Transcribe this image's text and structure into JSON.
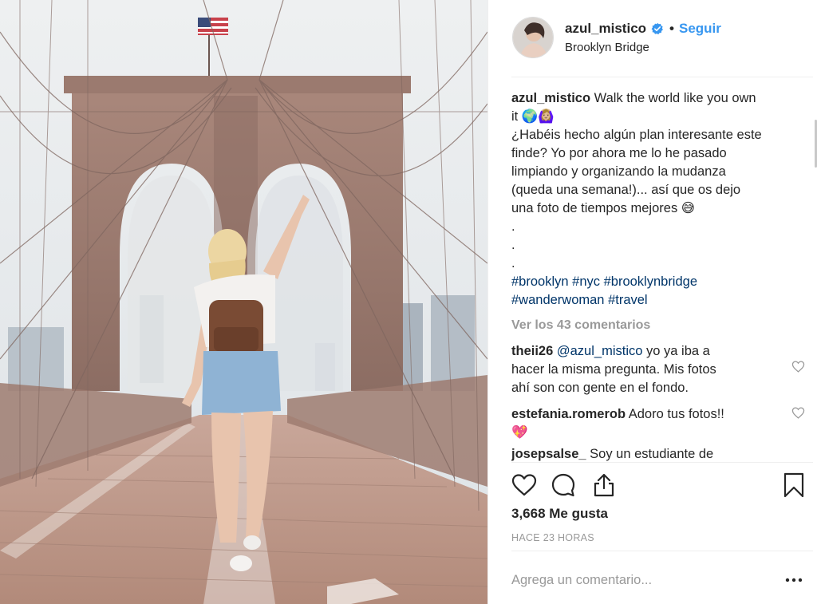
{
  "post": {
    "photo": {
      "alt": "Woman walking on Brooklyn Bridge with backpack"
    },
    "header": {
      "username": "azul_mistico",
      "separator": "•",
      "follow_label": "Seguir",
      "location": "Brooklyn Bridge"
    },
    "caption": {
      "username": "azul_mistico",
      "line1": "Walk the world like you own",
      "line2": "it 🌍🙆🏼‍♀️",
      "line3": "¿Habéis hecho algún plan interesante este",
      "line4": "finde? Yo por ahora me lo he pasado",
      "line5": "limpiando y organizando la mudanza",
      "line6": "(queda una semana!)... así que os dejo",
      "line7": "una foto de tiempos mejores 😅",
      "dots": [
        ".",
        ".",
        "."
      ],
      "hashtags_line1": [
        "#brooklyn",
        "#nyc",
        "#brooklynbridge"
      ],
      "hashtags_line2": [
        "#wanderwoman",
        "#travel"
      ]
    },
    "view_all_comments": "Ver los 43 comentarios",
    "comments": [
      {
        "username": "theii26",
        "mention": "@azul_mistico",
        "text1": "yo ya iba a",
        "text2": "hacer la misma pregunta. Mis fotos",
        "text3": "ahí son con gente en el fondo."
      },
      {
        "username": "estefania.romerob",
        "text1": "Adoro tus fotos!!",
        "text2": "💖"
      },
      {
        "username": "josepsalse_",
        "text1": "Soy un estudiante de"
      }
    ],
    "likes": "3,668 Me gusta",
    "timestamp": "HACE 23 HORAS",
    "comment_input": {
      "placeholder": "Agrega un comentario..."
    },
    "icons": {
      "like": "heart-icon",
      "comment": "comment-bubble-icon",
      "share": "share-icon",
      "save": "bookmark-icon",
      "more": "more-options-icon",
      "verified": "verified-badge-icon"
    },
    "colors": {
      "link_blue": "#3897f0",
      "hashtag_blue": "#003569",
      "muted_gray": "#999999",
      "text": "#262626"
    }
  }
}
